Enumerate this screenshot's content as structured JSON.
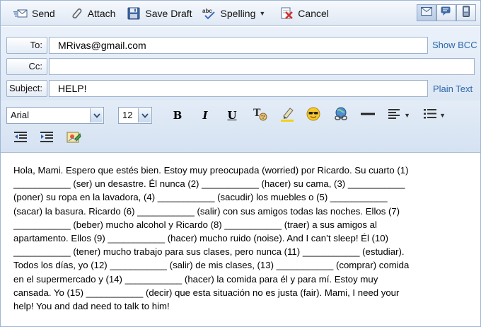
{
  "toolbar": {
    "send_label": "Send",
    "attach_label": "Attach",
    "save_draft_label": "Save Draft",
    "spelling_label": "Spelling",
    "cancel_label": "Cancel"
  },
  "header": {
    "to_label": "To:",
    "to_value": "MRivas@gmail.com",
    "cc_label": "Cc:",
    "cc_value": "",
    "subject_label": "Subject:",
    "subject_value": "HELP!",
    "show_bcc_label": "Show BCC",
    "plain_text_label": "Plain Text"
  },
  "format": {
    "font": "Arial",
    "size": "12",
    "bold": "B",
    "italic": "I",
    "underline": "U"
  },
  "body": {
    "lines": [
      "Hola, Mami. Espero que estés bien. Estoy muy preocupada (worried) por Ricardo. Su cuarto (1)",
      "___________ (ser) un desastre. Él nunca (2) ___________ (hacer) su cama, (3) ___________",
      "(poner) su ropa en la lavadora, (4) ___________ (sacudir) los muebles o (5) ___________",
      "(sacar) la basura. Ricardo (6) ___________ (salir) con sus amigos todas las noches. Ellos (7)",
      "___________ (beber) mucho alcohol y Ricardo (8) ___________ (traer) a sus amigos al",
      "apartamento. Ellos (9) ___________ (hacer) mucho ruido (noise). And I can’t sleep! Él (10)",
      "___________ (tener) mucho trabajo para sus clases, pero nunca (11) ___________ (estudiar).",
      "Todos los días, yo (12) ___________ (salir) de mis clases, (13) ___________ (comprar) comida",
      "en el supermercado y (14) ___________ (hacer) la comida para él y para mí. Estoy muy",
      "cansada. Yo (15) ___________ (decir) que esta situación no es justa (fair). Mami, I need your",
      "help! You and dad need to talk to him!"
    ]
  },
  "colors": {
    "link": "#2e67a8",
    "chrome_top": "#f6f9fd",
    "chrome_bottom": "#d5e2f2",
    "border": "#9eb2cd"
  }
}
